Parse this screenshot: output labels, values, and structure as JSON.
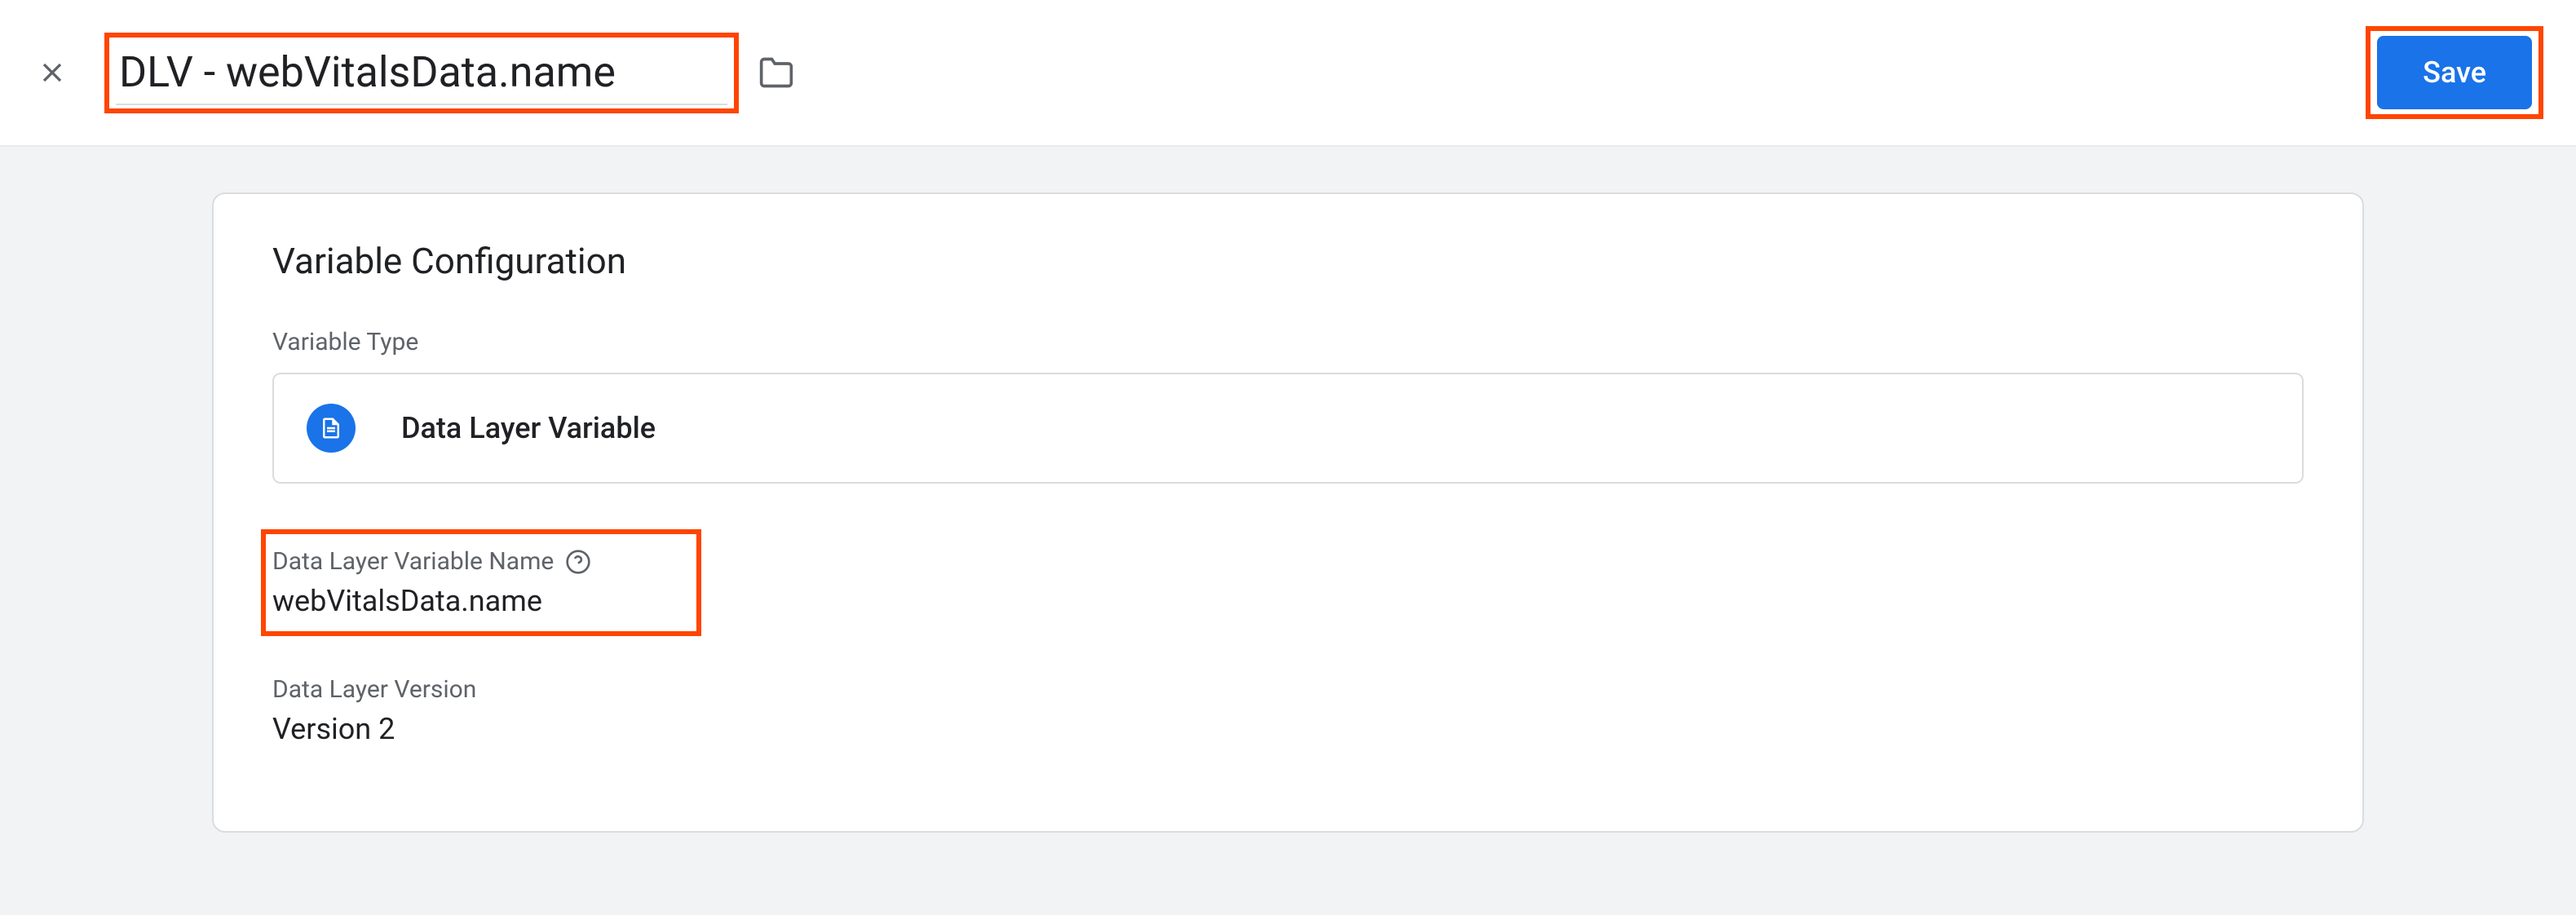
{
  "header": {
    "variable_name": "DLV - webVitalsData.name",
    "save_label": "Save"
  },
  "config": {
    "card_title": "Variable Configuration",
    "type_section_label": "Variable Type",
    "type_name": "Data Layer Variable",
    "dlv_name_label": "Data Layer Variable Name",
    "dlv_name_value": "webVitalsData.name",
    "version_label": "Data Layer Version",
    "version_value": "Version 2"
  }
}
